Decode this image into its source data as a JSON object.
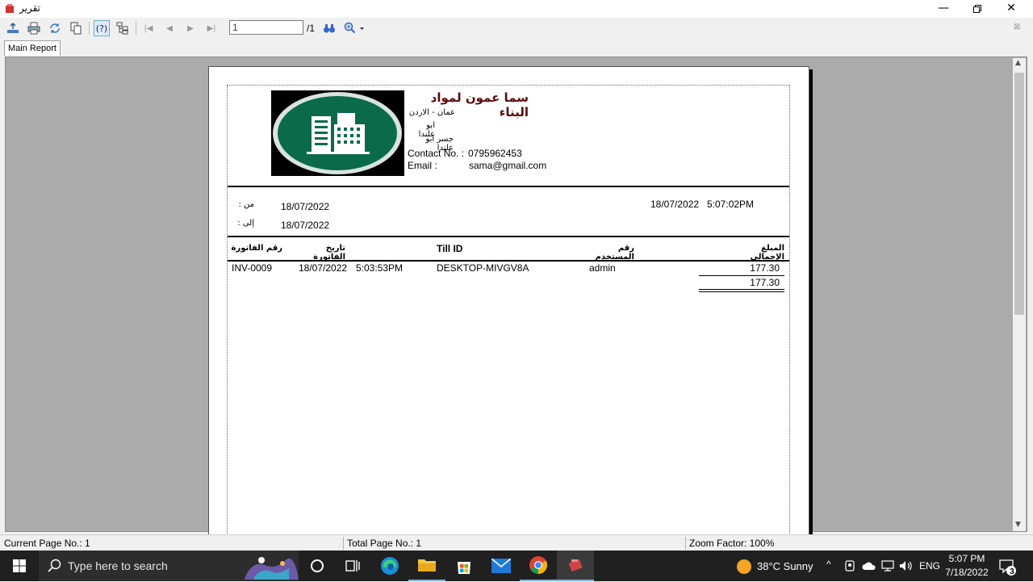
{
  "window": {
    "title": "تقرير"
  },
  "toolbar": {
    "page_value": "1",
    "page_total": "/1"
  },
  "tabs": {
    "main_report": "Main Report"
  },
  "report": {
    "company_name": "سما عمون لمواد البناء",
    "address_line1": "عمان - الاردن",
    "address_line2": "ابو علندا",
    "address_line3": "جسر ابو علندا",
    "contact_label": "Contact No. :",
    "contact_value": "0795962453",
    "email_label": "Email :",
    "email_value": "sama@gmail.com",
    "from_label": "من :",
    "from_date": "18/07/2022",
    "to_label": "إلى :",
    "to_date": "18/07/2022",
    "print_date": "18/07/2022",
    "print_time": "5:07:02PM",
    "columns": {
      "invoice_no": "رقم الفاتورة",
      "invoice_date": "تاريخ الفاتورة",
      "till_id": "Till ID",
      "user_no": "رقم المستخدم",
      "total_amount": "المبلغ الإجمالي"
    },
    "rows": [
      {
        "invoice_no": "INV-0009",
        "date": "18/07/2022",
        "time": "5:03:53PM",
        "till": "DESKTOP-MIVGV8A",
        "user": "admin",
        "amount": "177.30"
      }
    ],
    "grand_total": "177.30"
  },
  "status": {
    "current_page": "Current Page No.: 1",
    "total_page": "Total Page No.: 1",
    "zoom": "Zoom Factor: 100%"
  },
  "taskbar": {
    "search_placeholder": "Type here to search",
    "weather": "38°C  Sunny",
    "lang": "ENG",
    "time": "5:07 PM",
    "date": "7/18/2022",
    "notification_count": "3"
  },
  "colors": {
    "logo_green": "#0b6a4a",
    "company_name": "#5a0a0a",
    "taskbar": "#202020",
    "viewer_bg": "#ababab"
  }
}
